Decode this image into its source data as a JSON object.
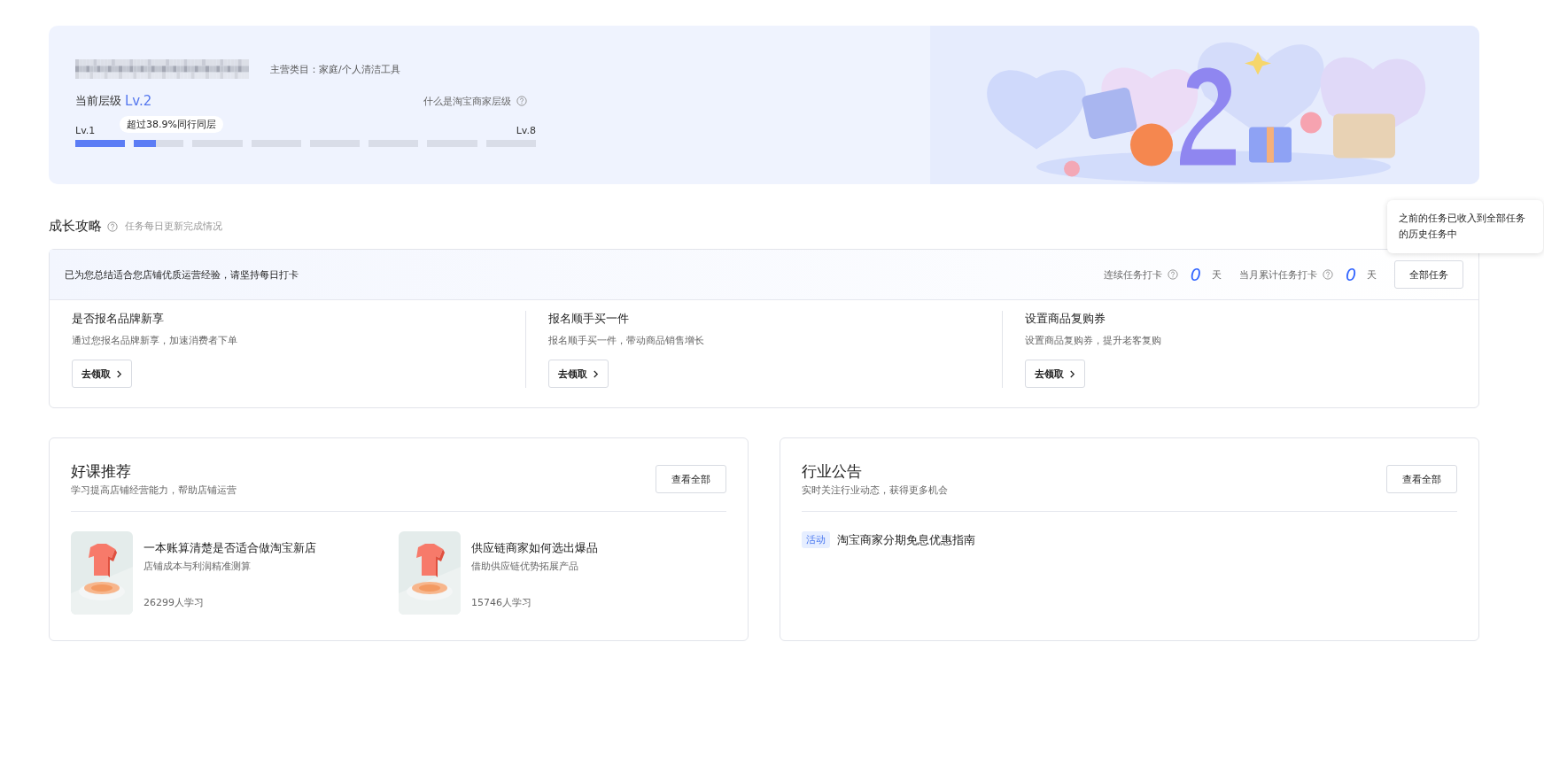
{
  "profile": {
    "category_label": "主营类目：家庭/个人清洁工具",
    "level_label": "当前层级",
    "level_value": "Lv.2",
    "help_link": "什么是淘宝商家层级",
    "min_label": "Lv.1",
    "max_label": "Lv.8",
    "progress_tip": "超过38.9%同行同层",
    "progress": {
      "level": 0.175
    }
  },
  "growth": {
    "title": "成长攻略",
    "subtitle": "任务每日更新完成情况",
    "banner": "已为您总结适合您店铺优质运营经验，请坚持每日打卡",
    "streak_label": "连续任务打卡",
    "streak_value": "0",
    "streak_unit": "天",
    "month_label": "当月累计任务打卡",
    "month_value": "0",
    "month_unit": "天",
    "all_button": "全部任务",
    "tooltip": "之前的任务已收入到全部任务的历史任务中",
    "tasks": [
      {
        "title": "是否报名品牌新享",
        "desc": "通过您报名品牌新享，加速消费者下单",
        "button": "去领取"
      },
      {
        "title": "报名顺手买一件",
        "desc": "报名顺手买一件，带动商品销售增长",
        "button": "去领取"
      },
      {
        "title": "设置商品复购券",
        "desc": "设置商品复购券，提升老客复购",
        "button": "去领取"
      }
    ]
  },
  "courses": {
    "title": "好课推荐",
    "subtitle": "学习提高店铺经营能力，帮助店铺运营",
    "button": "查看全部",
    "items": [
      {
        "title": "一本账算清楚是否适合做淘宝新店",
        "desc": "店铺成本与利润精准测算",
        "learners": "26299人学习"
      },
      {
        "title": "供应链商家如何选出爆品",
        "desc": "借助供应链优势拓展产品",
        "learners": "15746人学习"
      }
    ]
  },
  "notices": {
    "title": "行业公告",
    "subtitle": "实时关注行业动态，获得更多机会",
    "button": "查看全部",
    "items": [
      {
        "tag": "活动",
        "title": "淘宝商家分期免息优惠指南"
      }
    ]
  }
}
